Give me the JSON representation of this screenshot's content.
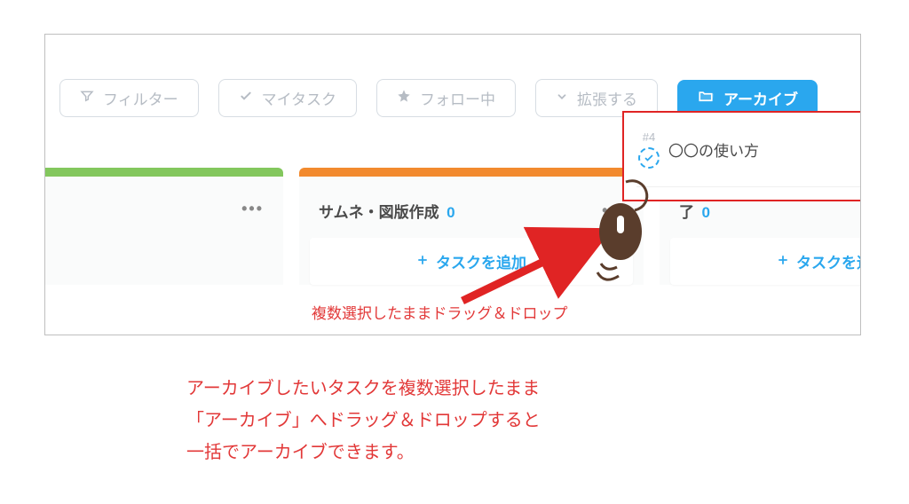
{
  "toolbar": {
    "filter": "フィルター",
    "mytask": "マイタスク",
    "follow": "フォロー中",
    "expand": "拡張する",
    "archive": "アーカイブ"
  },
  "columns": {
    "col1": {
      "title": "",
      "count": "",
      "add": ""
    },
    "col2": {
      "title": "サムネ・図版作成",
      "count": "0",
      "add": "タスクを追加"
    },
    "col3": {
      "title": "了",
      "count": "0",
      "add": "タスクを追加"
    }
  },
  "card": {
    "id": "#4",
    "title": "〇〇の使い方"
  },
  "annot": {
    "inline": "複数選択したままドラッグ＆ドロップ",
    "caption1": "アーカイブしたいタスクを複数選択したまま",
    "caption2": "「アーカイブ」へドラッグ＆ドロップすると",
    "caption3": "一括でアーカイブできます。"
  }
}
